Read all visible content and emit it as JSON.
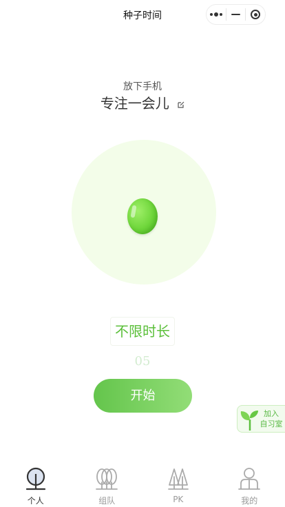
{
  "nav": {
    "title": "种子时间"
  },
  "header": {
    "subtitle": "放下手机",
    "headline": "专注一会儿"
  },
  "duration": {
    "label": "不限时长"
  },
  "timer": {
    "value": "05"
  },
  "start": {
    "label": "开始"
  },
  "join": {
    "line1": "加入",
    "line2": "自习室"
  },
  "tabs": [
    {
      "label": "个人",
      "icon": "tree-icon",
      "active": true
    },
    {
      "label": "组队",
      "icon": "team-trees-icon",
      "active": false
    },
    {
      "label": "PK",
      "icon": "pine-trees-icon",
      "active": false
    },
    {
      "label": "我的",
      "icon": "person-icon",
      "active": false
    }
  ],
  "colors": {
    "accent": "#5bbf3a",
    "seed": "#6fd63b",
    "circle": "#f3fde9"
  }
}
